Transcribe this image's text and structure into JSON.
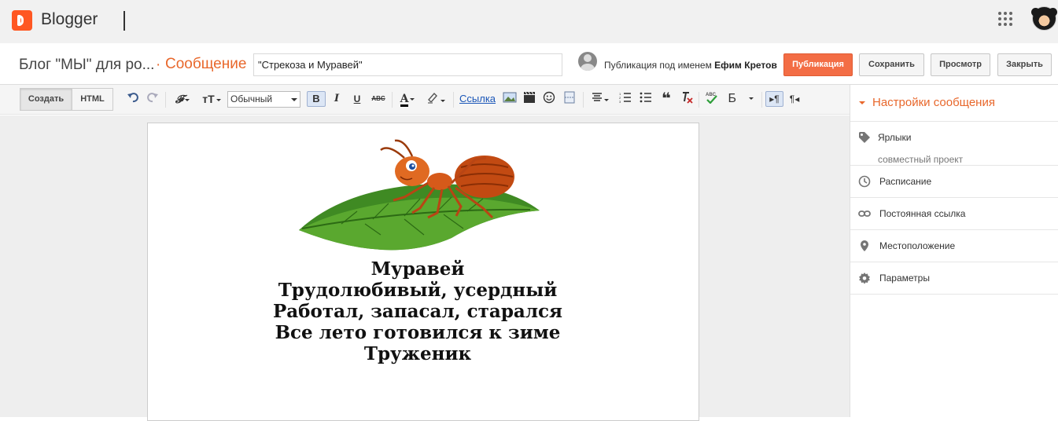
{
  "app": {
    "brand": "Blogger"
  },
  "post": {
    "blog_title": "Блог \"МЫ\" для ро...",
    "crumb_separator": "·",
    "crumb": "Сообщение",
    "title_value": "\"Стрекоза и Муравей\"",
    "publish_as_prefix": "Публикация под именем",
    "author": "Ефим Кретов"
  },
  "actions": {
    "publish": "Публикация",
    "save": "Сохранить",
    "preview": "Просмотр",
    "close": "Закрыть"
  },
  "toolbar": {
    "compose": "Создать",
    "html": "HTML",
    "font_icon": "𝓕",
    "size_icon": "тT",
    "style_value": "Обычный",
    "bold": "B",
    "italic": "I",
    "underline": "U",
    "strike": "ABC",
    "text_color": "A",
    "link": "Ссылка",
    "quote": "❝",
    "input_tools": "Б",
    "ltr": "▸¶",
    "rtl": "¶◂"
  },
  "content": {
    "poem_lines": [
      "Муравей",
      "Трудолюбивый, усердный",
      "Работал, запасал, старался",
      "Все лето готовился к зиме",
      "Труженик"
    ]
  },
  "sidebar": {
    "title": "Настройки сообщения",
    "labels": "Ярлыки",
    "labels_value": "совместный проект",
    "schedule": "Расписание",
    "permalink": "Постоянная ссылка",
    "location": "Местоположение",
    "options": "Параметры"
  },
  "colors": {
    "accent": "#e8672b",
    "publish_button": "#f36d45",
    "link": "#1a56b8"
  }
}
